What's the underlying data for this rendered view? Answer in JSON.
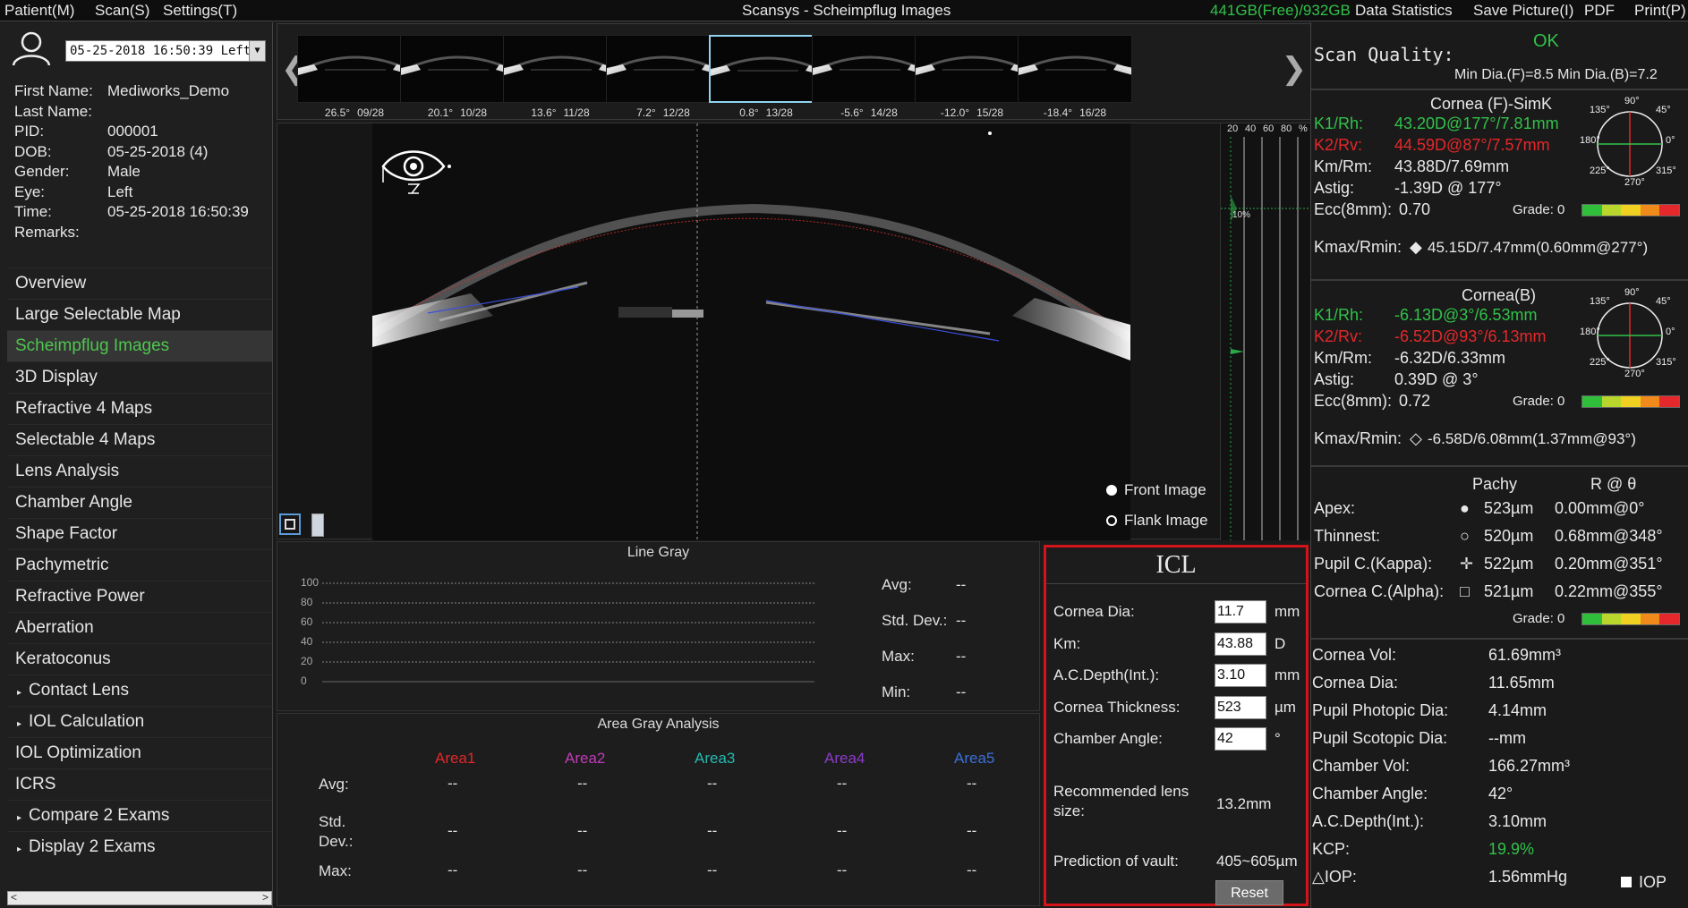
{
  "menubar": {
    "patient": "Patient(M)",
    "scan": "Scan(S)",
    "settings": "Settings(T)",
    "title": "Scansys - Scheimpflug Images",
    "disk": "441GB(Free)/932GB",
    "data_stats": "Data Statistics",
    "save_picture": "Save Picture(I)",
    "pdf": "PDF",
    "print": "Print(P)"
  },
  "patient": {
    "exam": "05-25-2018 16:50:39 Left",
    "rows": [
      {
        "label": "First Name:",
        "value": "Mediworks_Demo"
      },
      {
        "label": "Last Name:",
        "value": ""
      },
      {
        "label": "PID:",
        "value": "000001"
      },
      {
        "label": "DOB:",
        "value": "05-25-2018  (4)"
      },
      {
        "label": "Gender:",
        "value": "Male"
      },
      {
        "label": "Eye:",
        "value": "Left"
      },
      {
        "label": "Time:",
        "value": "05-25-2018 16:50:39"
      },
      {
        "label": "Remarks:",
        "value": ""
      }
    ]
  },
  "menu": [
    {
      "label": "Overview",
      "active": false,
      "expand": false
    },
    {
      "label": "Large Selectable Map",
      "active": false,
      "expand": false
    },
    {
      "label": "Scheimpflug Images",
      "active": true,
      "expand": false
    },
    {
      "label": "3D Display",
      "active": false,
      "expand": false
    },
    {
      "label": "Refractive 4 Maps",
      "active": false,
      "expand": false
    },
    {
      "label": "Selectable 4 Maps",
      "active": false,
      "expand": false
    },
    {
      "label": "Lens Analysis",
      "active": false,
      "expand": false
    },
    {
      "label": "Chamber Angle",
      "active": false,
      "expand": false
    },
    {
      "label": "Shape Factor",
      "active": false,
      "expand": false
    },
    {
      "label": "Pachymetric",
      "active": false,
      "expand": false
    },
    {
      "label": "Refractive Power",
      "active": false,
      "expand": false
    },
    {
      "label": "Aberration",
      "active": false,
      "expand": false
    },
    {
      "label": "Keratoconus",
      "active": false,
      "expand": false
    },
    {
      "label": "Contact Lens",
      "active": false,
      "expand": true
    },
    {
      "label": "IOL Calculation",
      "active": false,
      "expand": true
    },
    {
      "label": "IOL Optimization",
      "active": false,
      "expand": false
    },
    {
      "label": "ICRS",
      "active": false,
      "expand": false
    },
    {
      "label": "Compare 2 Exams",
      "active": false,
      "expand": true
    },
    {
      "label": "Display 2 Exams",
      "active": false,
      "expand": true
    }
  ],
  "thumbnails": [
    {
      "angle": "26.5°",
      "index": "09/28",
      "selected": false
    },
    {
      "angle": "20.1°",
      "index": "10/28",
      "selected": false
    },
    {
      "angle": "13.6°",
      "index": "11/28",
      "selected": false
    },
    {
      "angle": "7.2°",
      "index": "12/28",
      "selected": false
    },
    {
      "angle": "0.8°",
      "index": "13/28",
      "selected": true
    },
    {
      "angle": "-5.6°",
      "index": "14/28",
      "selected": false
    },
    {
      "angle": "-12.0°",
      "index": "15/28",
      "selected": false
    },
    {
      "angle": "-18.4°",
      "index": "16/28",
      "selected": false
    }
  ],
  "viewer": {
    "front_image": "Front Image",
    "flank_image": "Flank Image",
    "gray_scale": [
      "20",
      "40",
      "60",
      "80",
      "%"
    ],
    "gray_marker": "10%"
  },
  "line_gray": {
    "title": "Line Gray",
    "yticks": [
      "100",
      "80",
      "60",
      "40",
      "20",
      "0"
    ],
    "stats": [
      {
        "label": "Avg:",
        "value": "--"
      },
      {
        "label": "Std. Dev.:",
        "value": "--"
      },
      {
        "label": "Max:",
        "value": "--"
      },
      {
        "label": "Min:",
        "value": "--"
      }
    ]
  },
  "area_gray": {
    "title": "Area Gray Analysis",
    "areas": [
      {
        "name": "Area1",
        "color": "#e0282b"
      },
      {
        "name": "Area2",
        "color": "#c03cb8"
      },
      {
        "name": "Area3",
        "color": "#27b8b0"
      },
      {
        "name": "Area4",
        "color": "#8a3cc8"
      },
      {
        "name": "Area5",
        "color": "#3d6fd8"
      }
    ],
    "rows": [
      {
        "label": "Avg:",
        "values": [
          "--",
          "--",
          "--",
          "--",
          "--"
        ]
      },
      {
        "label": "Std.\nDev.:",
        "values": [
          "--",
          "--",
          "--",
          "--",
          "--"
        ]
      },
      {
        "label": "Max:",
        "values": [
          "--",
          "--",
          "--",
          "--",
          "--"
        ]
      }
    ]
  },
  "icl": {
    "title": "ICL",
    "fields": [
      {
        "label": "Cornea Dia:",
        "value": "11.7",
        "unit": "mm"
      },
      {
        "label": "Km:",
        "value": "43.88",
        "unit": "D"
      },
      {
        "label": "A.C.Depth(Int.):",
        "value": "3.10",
        "unit": "mm"
      },
      {
        "label": "Cornea Thickness:",
        "value": "523",
        "unit": "µm"
      },
      {
        "label": "Chamber Angle:",
        "value": "42",
        "unit": "°"
      }
    ],
    "recommended_label": "Recommended lens size:",
    "recommended_value": "13.2mm",
    "vault_label": "Prediction of vault:",
    "vault_value": "405~605µm",
    "reset": "Reset"
  },
  "right": {
    "scan_quality_label": "Scan Quality:",
    "scan_quality_value": "OK",
    "min_dia": "Min Dia.(F)=8.5  Min Dia.(B)=7.2",
    "front": {
      "title": "Cornea (F)-SimK",
      "k1_label": "K1/Rh:",
      "k1": "43.20D@177°/7.81mm",
      "k2_label": "K2/Rv:",
      "k2": "44.59D@87°/7.57mm",
      "km_label": "Km/Rm:",
      "km": "43.88D/7.69mm",
      "astig_label": "Astig:",
      "astig": "-1.39D @ 177°",
      "ecc_label": "Ecc(8mm):",
      "ecc": "0.70",
      "grade": "Grade: 0",
      "kmax_label": "Kmax/Rmin:",
      "kmax": "45.15D/7.47mm(0.60mm@277°)"
    },
    "back": {
      "title": "Cornea(B)",
      "k1_label": "K1/Rh:",
      "k1": "-6.13D@3°/6.53mm",
      "k2_label": "K2/Rv:",
      "k2": "-6.52D@93°/6.13mm",
      "km_label": "Km/Rm:",
      "km": "-6.32D/6.33mm",
      "astig_label": "Astig:",
      "astig": "0.39D @ 3°",
      "ecc_label": "Ecc(8mm):",
      "ecc": "0.72",
      "grade": "Grade: 0",
      "kmax_label": "Kmax/Rmin:",
      "kmax": "-6.58D/6.08mm(1.37mm@93°)"
    },
    "compass_labels": [
      "90°",
      "45°",
      "0°",
      "315°",
      "270°",
      "225°",
      "180°",
      "135°"
    ],
    "pachy": {
      "col1": "Pachy",
      "col2": "R @ θ",
      "rows": [
        {
          "label": "Apex:",
          "pachy": "523µm",
          "r": "0.00mm@0°",
          "marker": "filled-circle"
        },
        {
          "label": "Thinnest:",
          "pachy": "520µm",
          "r": "0.68mm@348°",
          "marker": "open-circle"
        },
        {
          "label": "Pupil C.(Kappa):",
          "pachy": "522µm",
          "r": "0.20mm@351°",
          "marker": "crosshair"
        },
        {
          "label": "Cornea C.(Alpha):",
          "pachy": "521µm",
          "r": "0.22mm@355°",
          "marker": "open-square"
        }
      ],
      "grade": "Grade: 0"
    },
    "stats": [
      {
        "label": "Cornea Vol:",
        "value": "61.69mm³"
      },
      {
        "label": "Cornea Dia:",
        "value": "11.65mm"
      },
      {
        "label": "Pupil Photopic Dia:",
        "value": "4.14mm"
      },
      {
        "label": "Pupil Scotopic Dia:",
        "value": "--mm"
      },
      {
        "label": "Chamber Vol:",
        "value": "166.27mm³"
      },
      {
        "label": "Chamber Angle:",
        "value": "42°"
      },
      {
        "label": "A.C.Depth(Int.):",
        "value": "3.10mm"
      },
      {
        "label": "KCP:",
        "value": "19.9%"
      },
      {
        "label": "△IOP:",
        "value": "1.56mmHg"
      }
    ],
    "iop_label": "IOP",
    "colors": {
      "red": "#e4282b",
      "green": "#31c24a",
      "accent_green": "#4ec74f"
    }
  }
}
